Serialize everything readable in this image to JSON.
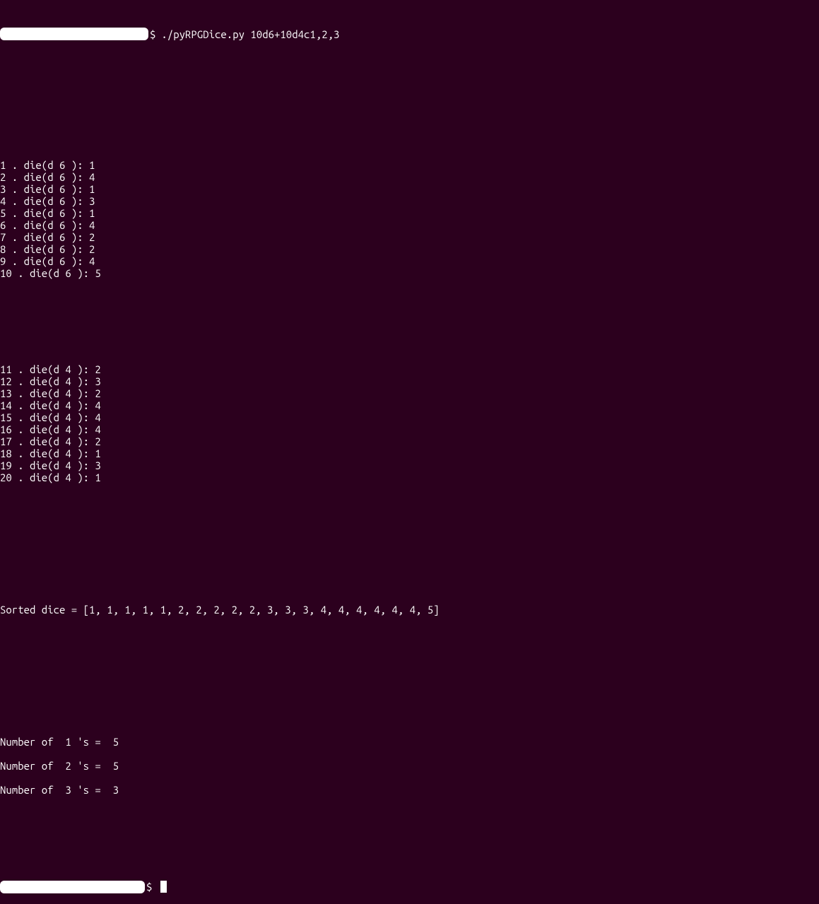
{
  "prompt": {
    "symbol": "$",
    "command": "./pyRPGDice.py 10d6+10d4c1,2,3"
  },
  "rolls_d6": [
    {
      "idx": "1",
      "sides": "6",
      "val": "1"
    },
    {
      "idx": "2",
      "sides": "6",
      "val": "4"
    },
    {
      "idx": "3",
      "sides": "6",
      "val": "1"
    },
    {
      "idx": "4",
      "sides": "6",
      "val": "3"
    },
    {
      "idx": "5",
      "sides": "6",
      "val": "1"
    },
    {
      "idx": "6",
      "sides": "6",
      "val": "4"
    },
    {
      "idx": "7",
      "sides": "6",
      "val": "2"
    },
    {
      "idx": "8",
      "sides": "6",
      "val": "2"
    },
    {
      "idx": "9",
      "sides": "6",
      "val": "4"
    },
    {
      "idx": "10",
      "sides": "6",
      "val": "5"
    }
  ],
  "rolls_d4": [
    {
      "idx": "11",
      "sides": "4",
      "val": "2"
    },
    {
      "idx": "12",
      "sides": "4",
      "val": "3"
    },
    {
      "idx": "13",
      "sides": "4",
      "val": "2"
    },
    {
      "idx": "14",
      "sides": "4",
      "val": "4"
    },
    {
      "idx": "15",
      "sides": "4",
      "val": "4"
    },
    {
      "idx": "16",
      "sides": "4",
      "val": "4"
    },
    {
      "idx": "17",
      "sides": "4",
      "val": "2"
    },
    {
      "idx": "18",
      "sides": "4",
      "val": "1"
    },
    {
      "idx": "19",
      "sides": "4",
      "val": "3"
    },
    {
      "idx": "20",
      "sides": "4",
      "val": "1"
    }
  ],
  "sorted_line": "Sorted dice = [1, 1, 1, 1, 1, 2, 2, 2, 2, 2, 3, 3, 3, 4, 4, 4, 4, 4, 4, 5]",
  "counts": [
    {
      "n": "1",
      "c": "5"
    },
    {
      "n": "2",
      "c": "5"
    },
    {
      "n": "3",
      "c": "3"
    }
  ],
  "labels": {
    "die_prefix": " . die(d ",
    "die_mid": " ): ",
    "count_prefix": "Number of  ",
    "count_mid": " 's =  "
  }
}
